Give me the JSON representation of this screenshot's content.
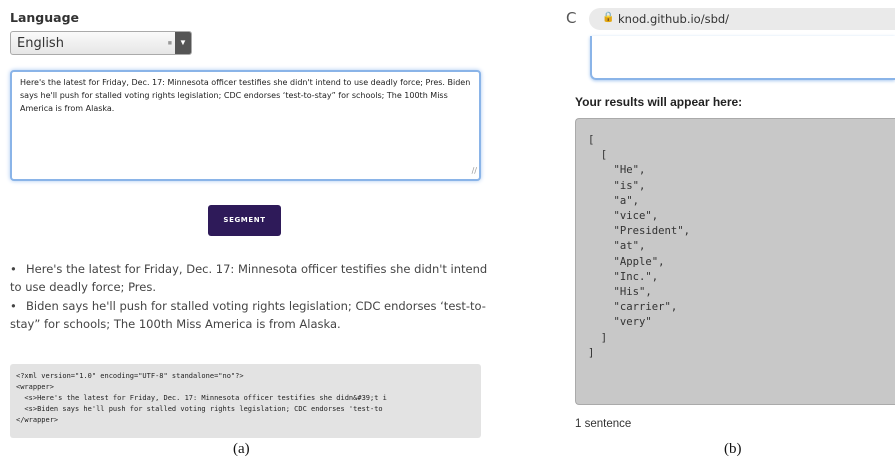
{
  "panel_a": {
    "language_label": "Language",
    "language_selected": "English",
    "input_text": "Here's the latest for Friday, Dec. 17: Minnesota officer testifies she didn't intend to use deadly force; Pres. Biden says he'll push for stalled voting rights legislation; CDC endorses ‘test-to-stay” for schools; The 100th Miss America is from Alaska.",
    "segment_button": "SEGMENT",
    "bullet_char": "•",
    "sentences": [
      "Here's the latest for Friday, Dec. 17: Minnesota officer testifies she didn't intend to use deadly force; Pres.",
      "Biden says he'll push for stalled voting rights legislation; CDC endorses ‘test-to-stay” for schools; The 100th Miss America is from Alaska."
    ],
    "xml_lines": [
      "<?xml version=\"1.0\" encoding=\"UTF-8\" standalone=\"no\"?>",
      "<wrapper>",
      "  <s>Here's the latest for Friday, Dec. 17: Minnesota officer testifies she didn&#39;t i",
      "  <s>Biden says he'll push for stalled voting rights legislation; CDC endorses 'test-to",
      "</wrapper>"
    ],
    "caption": "(a)"
  },
  "panel_b": {
    "url": "knod.github.io/sbd/",
    "results_heading": "Your results will appear here:",
    "result_text": "[\n  [\n    \"He\",\n    \"is\",\n    \"a\",\n    \"vice\",\n    \"President\",\n    \"at\",\n    \"Apple\",\n    \"Inc.\",\n    \"His\",\n    \"carrier\",\n    \"very\"\n  ]\n]",
    "sentence_count": "1 sentence",
    "caption": "(b)"
  },
  "icons": {
    "reload": "reload-icon",
    "lock": "lock-icon",
    "dropdown": "chevron-down-icon",
    "resize": "resize-handle-icon"
  }
}
